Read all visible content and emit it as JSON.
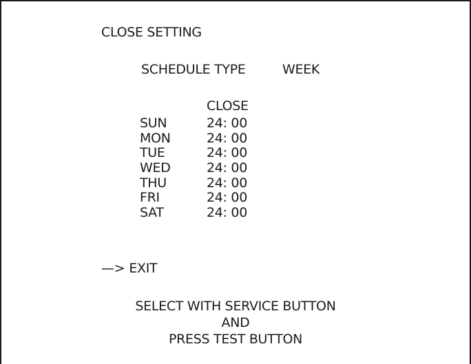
{
  "screen": {
    "title": "CLOSE SETTING",
    "schedule_type_label": "SCHEDULE TYPE",
    "schedule_type_value": "WEEK",
    "column_header": "CLOSE",
    "days": [
      {
        "day": "SUN",
        "time": "24: 00"
      },
      {
        "day": "MON",
        "time": "24: 00"
      },
      {
        "day": "TUE",
        "time": "24: 00"
      },
      {
        "day": "WED",
        "time": "24: 00"
      },
      {
        "day": "THU",
        "time": "24: 00"
      },
      {
        "day": "FRI",
        "time": "24: 00"
      },
      {
        "day": "SAT",
        "time": "24: 00"
      }
    ],
    "cursor": "—>",
    "exit_label": "EXIT",
    "instructions": [
      "SELECT WITH SERVICE BUTTON",
      "AND",
      "PRESS TEST BUTTON"
    ]
  },
  "colors": {
    "background": "#ffffff",
    "text": "#1a1a1a"
  }
}
